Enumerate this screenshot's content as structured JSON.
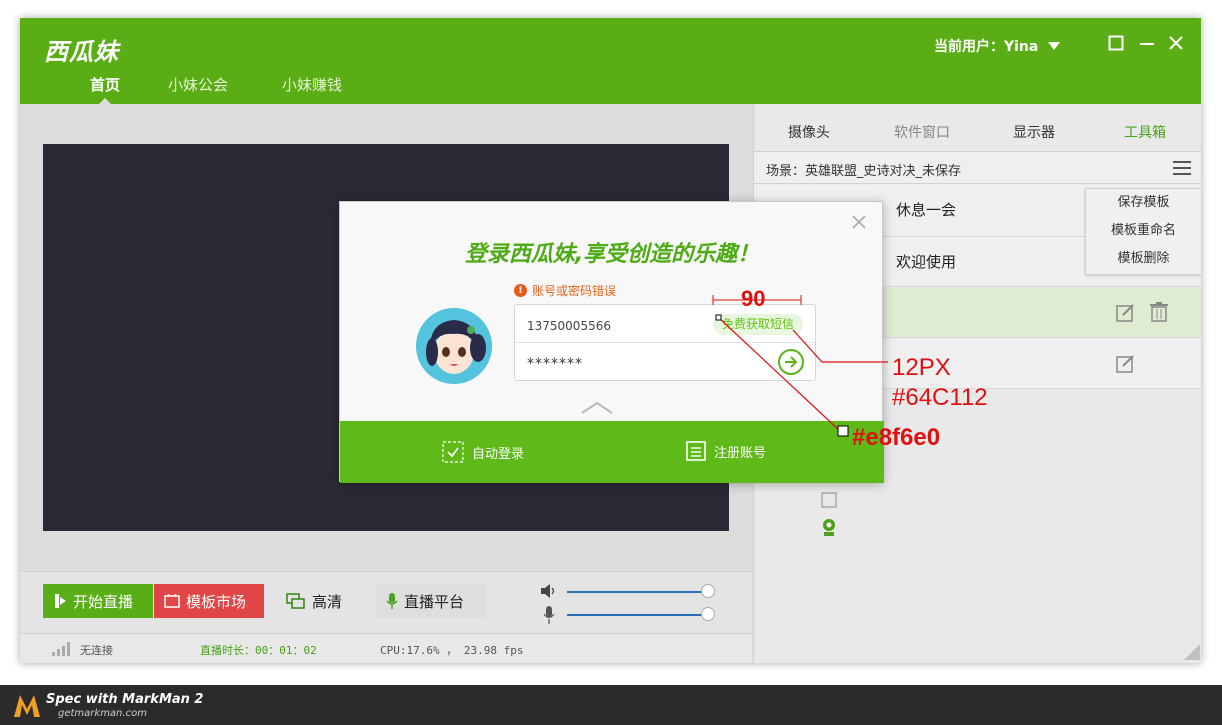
{
  "app": {
    "logo": "西瓜妹",
    "current_user": "当前用户：Yina",
    "nav": [
      "首页",
      "小妹公会",
      "小妹赚钱"
    ]
  },
  "controls": {
    "start_live": "开始直播",
    "template_market": "模板市场",
    "hd": "高清",
    "live_platform": "直播平台"
  },
  "status": {
    "connection": "无连接",
    "duration": "直播时长：00：01：02",
    "perf": "CPU:17.6% ， 23.98 fps"
  },
  "right_panel": {
    "tabs": [
      "摄像头",
      "软件窗口",
      "显示器",
      "工具箱"
    ],
    "scene": "场景：英雄联盟_史诗对决_未保存",
    "row1_text": "休息一会",
    "row2_text": "欢迎使用",
    "menu": [
      "保存模板",
      "模板重命名",
      "模板删除"
    ]
  },
  "dialog": {
    "title": "登录西瓜妹,享受创造的乐趣！",
    "error": "账号或密码错误",
    "account": "13750005566",
    "password": "*******",
    "sms_button": "免费获取短信",
    "auto_login": "自动登录",
    "register": "注册账号"
  },
  "spec": {
    "width_label": "90",
    "font_size_label": "12PX",
    "text_color_label": "#64C112",
    "bg_color_label": "#e8f6e0"
  },
  "footer": {
    "brand_line1": "Spec with MarkMan 2",
    "brand_line2": "getmarkman.com"
  },
  "colors": {
    "primary_green": "#5aad14",
    "sms_text": "#64c112",
    "sms_bg": "#e8f6e0",
    "market_red": "#e04646",
    "error_orange": "#e8621a"
  }
}
